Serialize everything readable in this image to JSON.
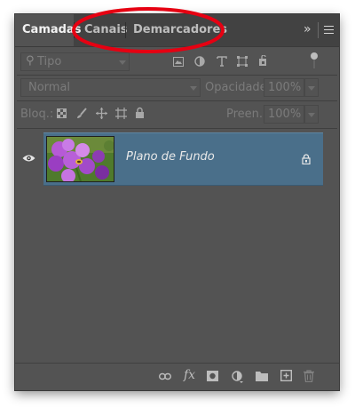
{
  "tabs": {
    "layers": "Camadas",
    "channels": "Canais",
    "paths": "Demarcadores",
    "collapse_glyph": "»"
  },
  "filter": {
    "kind_label": "Tipo"
  },
  "blend": {
    "mode": "Normal",
    "opacity_label": "Opacidade:",
    "opacity_value": "100%"
  },
  "lock": {
    "label": "Bloq.:",
    "fill_label": "Preen.:",
    "fill_value": "100%"
  },
  "layer": {
    "name": "Plano de Fundo"
  },
  "bottom": {
    "fx_label": "fx"
  },
  "colors": {
    "panel_bg": "#535353",
    "selected_layer": "#4a6f8a",
    "annotation": "#e60012"
  }
}
